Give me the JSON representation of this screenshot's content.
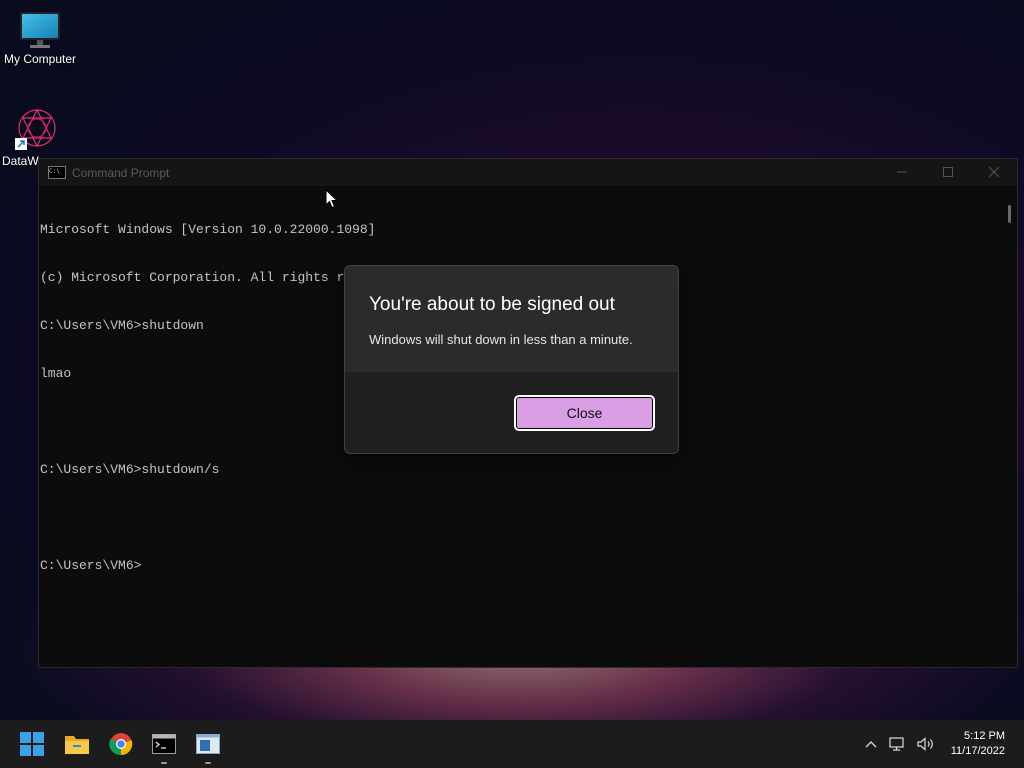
{
  "desktop": {
    "icons": [
      {
        "label": "My Computer",
        "icon": "monitor-icon"
      },
      {
        "label": "DataW",
        "icon": "datawrapper-shortcut-icon"
      }
    ]
  },
  "cmd_window": {
    "title": "Command Prompt",
    "lines": [
      "Microsoft Windows [Version 10.0.22000.1098]",
      "(c) Microsoft Corporation. All rights reserved.",
      "C:\\Users\\VM6>shutdown",
      "lmao",
      "",
      "C:\\Users\\VM6>shutdown/s",
      "",
      "C:\\Users\\VM6>"
    ]
  },
  "dialog": {
    "title": "You're about to be signed out",
    "message": "Windows will shut down in less than a minute.",
    "close_label": "Close"
  },
  "taskbar": {
    "apps": [
      "start-icon",
      "file-explorer-icon",
      "chrome-icon",
      "command-prompt-icon",
      "notepad-icon"
    ],
    "time": "5:12 PM",
    "date": "11/17/2022"
  },
  "colors": {
    "button_accent": "#d99ee3",
    "taskbar": "#1c1c1c",
    "console_bg": "#0c0c0c"
  }
}
